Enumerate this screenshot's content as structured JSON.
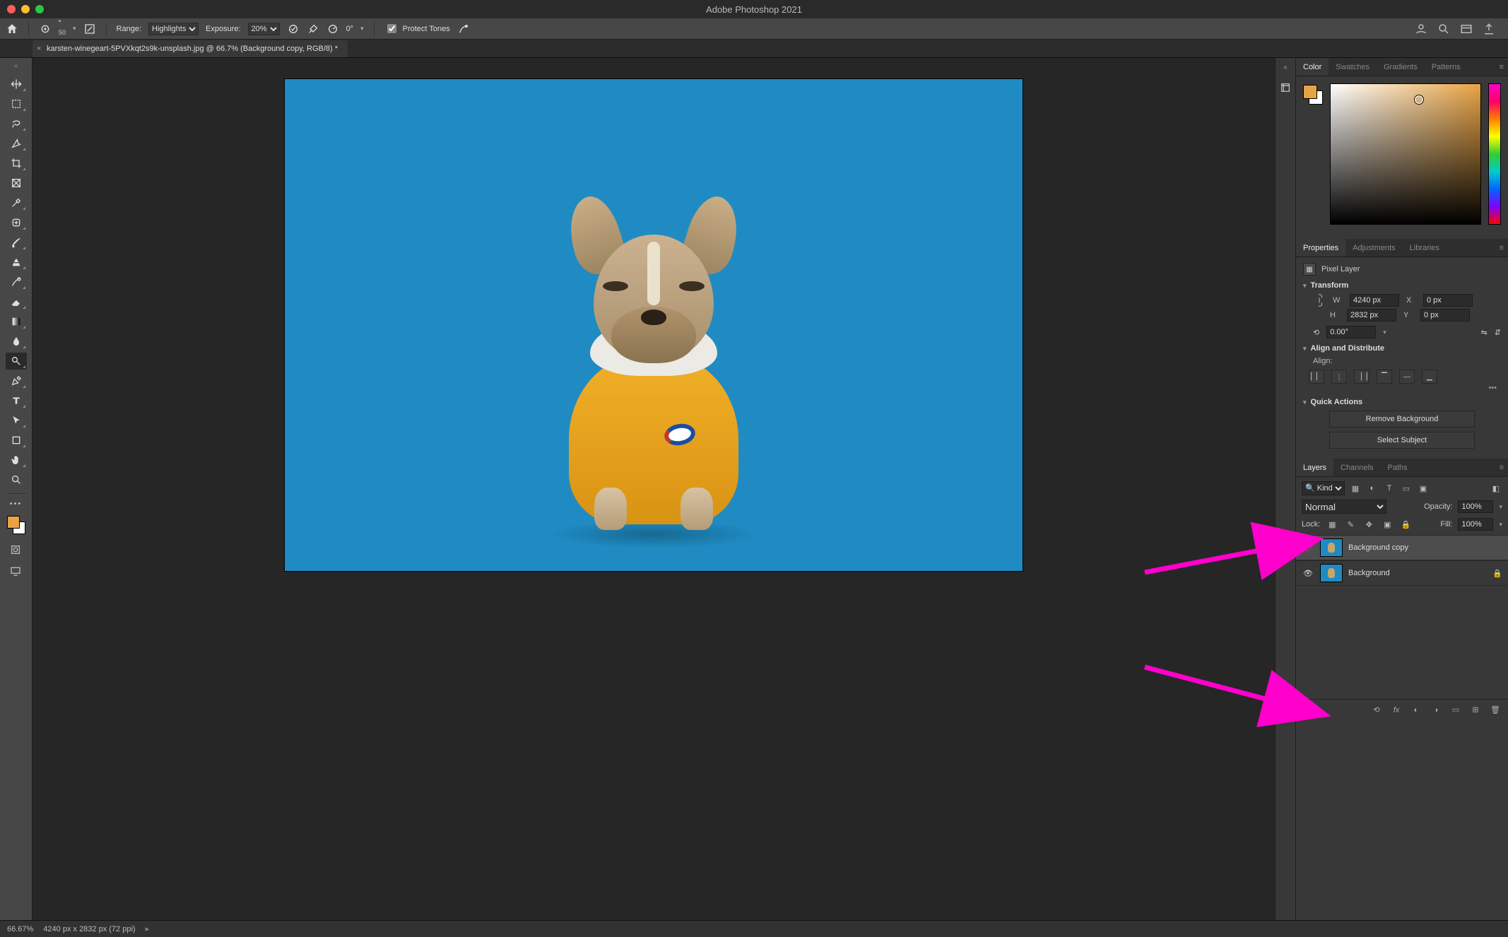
{
  "app": {
    "title": "Adobe Photoshop 2021"
  },
  "traffic": {
    "close": "#ff5f57",
    "min": "#febc2e",
    "max": "#28c840"
  },
  "options": {
    "brush_size": "50",
    "range_label": "Range:",
    "range_value": "Highlights",
    "exposure_label": "Exposure:",
    "exposure_value": "20%",
    "angle_label": "0°",
    "protect_tones": "Protect Tones"
  },
  "doc_tab": {
    "title": "karsten-winegeart-5PVXkqt2s9k-unsplash.jpg @ 66.7% (Background copy, RGB/8) *"
  },
  "color_tabs": {
    "a": "Color",
    "b": "Swatches",
    "c": "Gradients",
    "d": "Patterns"
  },
  "properties": {
    "tabs": {
      "a": "Properties",
      "b": "Adjustments",
      "c": "Libraries"
    },
    "kind": "Pixel Layer",
    "transform_hdr": "Transform",
    "w_label": "W",
    "w_value": "4240 px",
    "h_label": "H",
    "h_value": "2832 px",
    "x_label": "X",
    "x_value": "0 px",
    "y_label": "Y",
    "y_value": "0 px",
    "angle": "0.00°",
    "align_hdr": "Align and Distribute",
    "align_label": "Align:",
    "quick_hdr": "Quick Actions",
    "qa_remove": "Remove Background",
    "qa_select": "Select Subject"
  },
  "layers": {
    "tabs": {
      "a": "Layers",
      "b": "Channels",
      "c": "Paths"
    },
    "kind_prefix": "Kind",
    "blend": "Normal",
    "opacity_label": "Opacity:",
    "opacity_value": "100%",
    "lock_label": "Lock:",
    "fill_label": "Fill:",
    "fill_value": "100%",
    "items": [
      {
        "name": "Background copy",
        "selected": true,
        "locked": false,
        "visible": false
      },
      {
        "name": "Background",
        "selected": false,
        "locked": true,
        "visible": true
      }
    ]
  },
  "status": {
    "zoom": "66.67%",
    "dims": "4240 px x 2832 px (72 ppi)"
  },
  "tools": [
    "move",
    "artboard",
    "lasso",
    "magic-wand",
    "crop",
    "frame",
    "eyedropper",
    "healing-brush",
    "brush",
    "clone-stamp",
    "history-brush",
    "eraser",
    "gradient",
    "blur",
    "dodge",
    "pen",
    "type",
    "path-select",
    "rectangle",
    "hand",
    "zoom"
  ]
}
